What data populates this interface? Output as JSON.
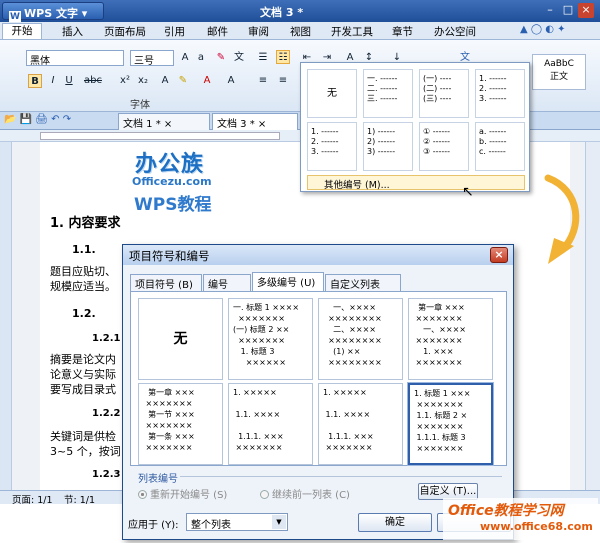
{
  "app": {
    "name": "WPS 文字",
    "doc_title": "文档 3 *"
  },
  "menu": [
    "开始",
    "插入",
    "页面布局",
    "引用",
    "邮件",
    "审阅",
    "视图",
    "开发工具",
    "章节",
    "办公空间"
  ],
  "ribbon": {
    "font": "黑体",
    "size": "三号",
    "group_label": "字体",
    "style_preview": "AaBbC",
    "style_name": "正文"
  },
  "tabs": [
    {
      "label": "文档 1 *"
    },
    {
      "label": "文档 3 *"
    }
  ],
  "dropdown": {
    "none_label": "无",
    "cells": [
      "一. ------\n二. ------\n三. ------",
      "(一) ----\n(二) ----\n(三) ----",
      "1. ------\n2. ------\n3. ------",
      "1. ------\n2. ------\n3. ------",
      "1) ------\n2) ------\n3) ------",
      "① ------\n② ------\n③ ------",
      "a. ------\nb. ------\nc. ------"
    ],
    "more": "其他编号 (M)..."
  },
  "logo": {
    "line1": "办公族",
    "line2": "Officezu.com",
    "line3": "WPS教程"
  },
  "document": {
    "h1": "1. 内容要求",
    "h2a": "1.1.",
    "p1": "题目应贴切、",
    "p2": "规模应适当。",
    "h2b": "1.2.",
    "h3a": "1.2.1",
    "p3": "摘要是论文内",
    "p4": "论意义与实际",
    "p5": "要写成目录式",
    "h3b": "1.2.2",
    "p6": "关键词是供检",
    "p7": "3~5 个，按词",
    "h3c": "1.2.3"
  },
  "status": {
    "page": "页面: 1/1",
    "section": "节: 1/1"
  },
  "dialog": {
    "title": "项目符号和编号",
    "tabs": [
      "项目符号 (B)",
      "编号 (N)",
      "多级编号 (U)",
      "自定义列表 (L)"
    ],
    "active_tab": 2,
    "none_label": "无",
    "cells": [
      "一. 标题 1 ××××\n  ×××××××\n(一) 标题 2 ××\n  ×××××××\n   1. 标题 3\n     ××××××",
      "    一、××××\n  ××××××××\n    二、××××\n  ××××××××\n    (1) ××\n  ××××××××",
      "  第一章 ×××\n ×××××××\n    一、××××\n ×××××××\n    1. ×××\n ×××××××",
      "  第一章 ×××\n ×××××××\n  第一节 ×××\n ×××××××\n  第一条 ×××\n ×××××××",
      "1. ×××××\n\n 1.1. ××××\n\n  1.1.1. ×××\n ×××××××",
      "1. ×××××\n\n 1.1. ××××\n\n  1.1.1. ×××\n ×××××××",
      "1. 标题 1 ×××\n ×××××××\n 1.1. 标题 2 ×\n ×××××××\n 1.1.1. 标题 3\n ×××××××"
    ],
    "list_group": "列表编号",
    "radio_restart": "重新开始编号 (S)",
    "radio_continue": "继续前一列表 (C)",
    "custom_btn": "自定义 (T)...",
    "apply_label": "应用于 (Y):",
    "apply_value": "整个列表",
    "ok": "确定"
  },
  "watermark": {
    "main": "Office教程学习网",
    "url": "www.office68.com"
  }
}
